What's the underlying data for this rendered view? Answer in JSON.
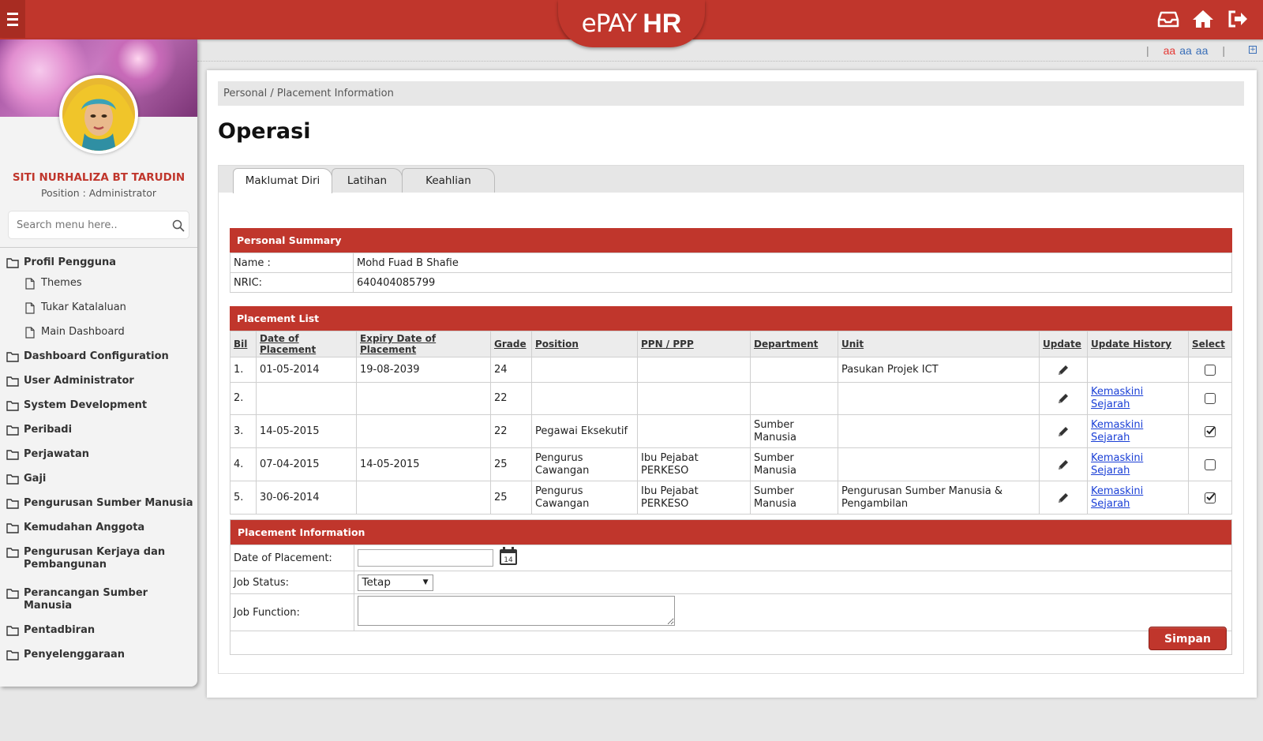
{
  "header": {
    "menu_icon": "hamburger-icon",
    "logo_part1": "ePAY",
    "logo_part2": "HR",
    "icons": [
      "inbox-icon",
      "home-icon",
      "logout-icon"
    ],
    "brand_color": "#c0362c"
  },
  "font_sizer": {
    "separator": "|",
    "sizes": [
      "aa",
      "aa",
      "aa"
    ],
    "colors": [
      "#e53935",
      "#3a6fb8",
      "#3a6fb8"
    ],
    "expand_label": "+"
  },
  "sidebar": {
    "user_name": "SITI NURHALIZA BT TARUDIN",
    "position_line": "Position : Administrator",
    "search_placeholder": "Search menu here..",
    "items": [
      {
        "type": "folder",
        "label": "Profil Pengguna"
      },
      {
        "type": "page",
        "label": "Themes"
      },
      {
        "type": "page",
        "label": "Tukar Katalaluan"
      },
      {
        "type": "page",
        "label": "Main Dashboard"
      },
      {
        "type": "folder",
        "label": "Dashboard Configuration"
      },
      {
        "type": "folder",
        "label": "User Administrator"
      },
      {
        "type": "folder",
        "label": "System Development"
      },
      {
        "type": "folder",
        "label": "Peribadi"
      },
      {
        "type": "folder",
        "label": "Perjawatan"
      },
      {
        "type": "folder",
        "label": "Gaji"
      },
      {
        "type": "folder",
        "label": "Pengurusan Sumber Manusia"
      },
      {
        "type": "folder",
        "label": "Kemudahan Anggota"
      },
      {
        "type": "folder",
        "label": "Pengurusan Kerjaya dan Pembangunan"
      },
      {
        "type": "folder",
        "label": "Perancangan Sumber Manusia"
      },
      {
        "type": "folder",
        "label": "Pentadbiran"
      },
      {
        "type": "folder",
        "label": "Penyelenggaraan"
      }
    ]
  },
  "main": {
    "breadcrumb": "Personal / Placement Information",
    "title": "Operasi",
    "tabs": [
      "Maklumat Diri",
      "Latihan",
      "Keahlian"
    ],
    "active_tab": "Maklumat Diri",
    "personal_summary": {
      "heading": "Personal Summary",
      "name_label": "Name :",
      "name_value": "Mohd Fuad B Shafie",
      "nric_label": "NRIC:",
      "nric_value": "640404085799"
    },
    "placement_list": {
      "heading": "Placement List",
      "columns": [
        "Bil",
        "Date of Placement",
        "Expiry Date of Placement",
        "Grade",
        "Position",
        "PPN / PPP",
        "Department",
        "Unit",
        "Update",
        "Update History",
        "Select"
      ],
      "rows": [
        {
          "bil": "1.",
          "date": "01-05-2014",
          "expiry": "19-08-2039",
          "grade": "24",
          "position": "",
          "ppn": "",
          "department": "",
          "unit": "Pasukan Projek ICT",
          "history": "",
          "selected": false
        },
        {
          "bil": "2.",
          "date": "",
          "expiry": "",
          "grade": "22",
          "position": "",
          "ppn": "",
          "department": "",
          "unit": "",
          "history": "Kemaskini Sejarah",
          "selected": false
        },
        {
          "bil": "3.",
          "date": "14-05-2015",
          "expiry": "",
          "grade": "22",
          "position": "Pegawai Eksekutif",
          "ppn": "",
          "department": "Sumber Manusia",
          "unit": "",
          "history": "Kemaskini Sejarah",
          "selected": true
        },
        {
          "bil": "4.",
          "date": "07-04-2015",
          "expiry": "14-05-2015",
          "grade": "25",
          "position": "Pengurus Cawangan",
          "ppn": "Ibu Pejabat PERKESO",
          "department": "Sumber Manusia",
          "unit": "",
          "history": "Kemaskini Sejarah",
          "selected": false
        },
        {
          "bil": "5.",
          "date": "30-06-2014",
          "expiry": "",
          "grade": "25",
          "position": "Pengurus Cawangan",
          "ppn": "Ibu Pejabat PERKESO",
          "department": "Sumber Manusia",
          "unit": "Pengurusan Sumber Manusia & Pengambilan",
          "history": "Kemaskini Sejarah",
          "selected": true
        }
      ]
    },
    "placement_info": {
      "heading": "Placement Information",
      "date_label": "Date of Placement:",
      "date_value": "",
      "calendar_day": "14",
      "status_label": "Job Status:",
      "status_value": "Tetap",
      "function_label": "Job Function:",
      "function_value": "",
      "save_label": "Simpan"
    }
  }
}
